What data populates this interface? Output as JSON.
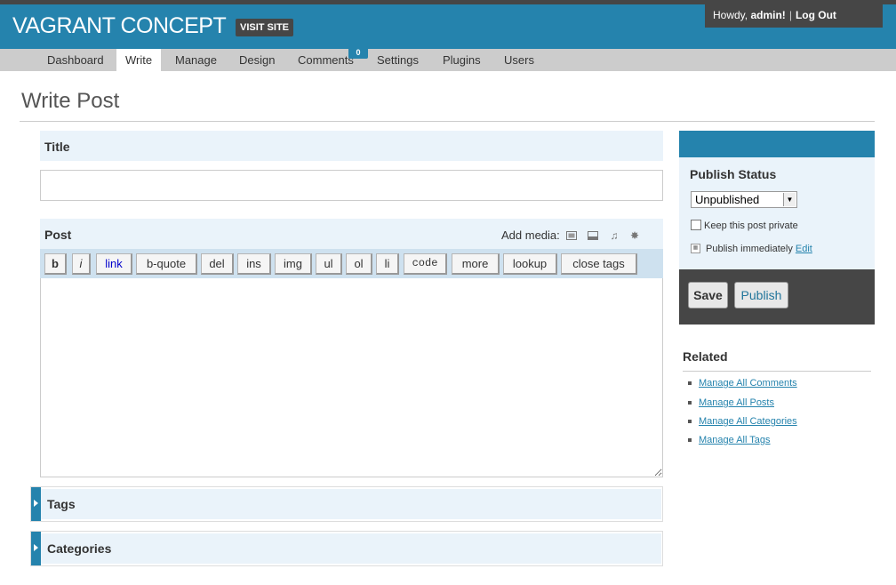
{
  "header": {
    "site_title": "VAGRANT CONCEPT",
    "visit_site": "VISIT SITE",
    "howdy": "Howdy, ",
    "user": "admin!",
    "separator": "|",
    "logout": "Log Out"
  },
  "nav": {
    "items": [
      "Dashboard",
      "Write",
      "Manage",
      "Design",
      "Comments",
      "Settings",
      "Plugins",
      "Users"
    ],
    "comments_badge": "0"
  },
  "page": {
    "title": "Write Post"
  },
  "form": {
    "title_label": "Title",
    "title_value": "",
    "post_label": "Post",
    "add_media": "Add media:",
    "toolbar": [
      "b",
      "i",
      "link",
      "b-quote",
      "del",
      "ins",
      "img",
      "ul",
      "ol",
      "li",
      "code",
      "more",
      "lookup",
      "close tags"
    ],
    "tags_label": "Tags",
    "categories_label": "Categories"
  },
  "publish": {
    "title": "Publish Status",
    "status_selected": "Unpublished",
    "private_label": "Keep this post private",
    "publish_when": "Publish immediately",
    "edit_link": "Edit",
    "save": "Save",
    "publish": "Publish"
  },
  "related": {
    "title": "Related",
    "links": [
      "Manage All Comments",
      "Manage All Posts",
      "Manage All Categories",
      "Manage All Tags"
    ]
  },
  "icons": {
    "media": [
      "image-icon",
      "video-icon",
      "music-icon",
      "media-icon"
    ]
  },
  "colors": {
    "brand_blue": "#2583ad",
    "dark_gray": "#464646",
    "light_blue": "#eaf3fa",
    "toolbar_blue": "#cee1ef"
  }
}
